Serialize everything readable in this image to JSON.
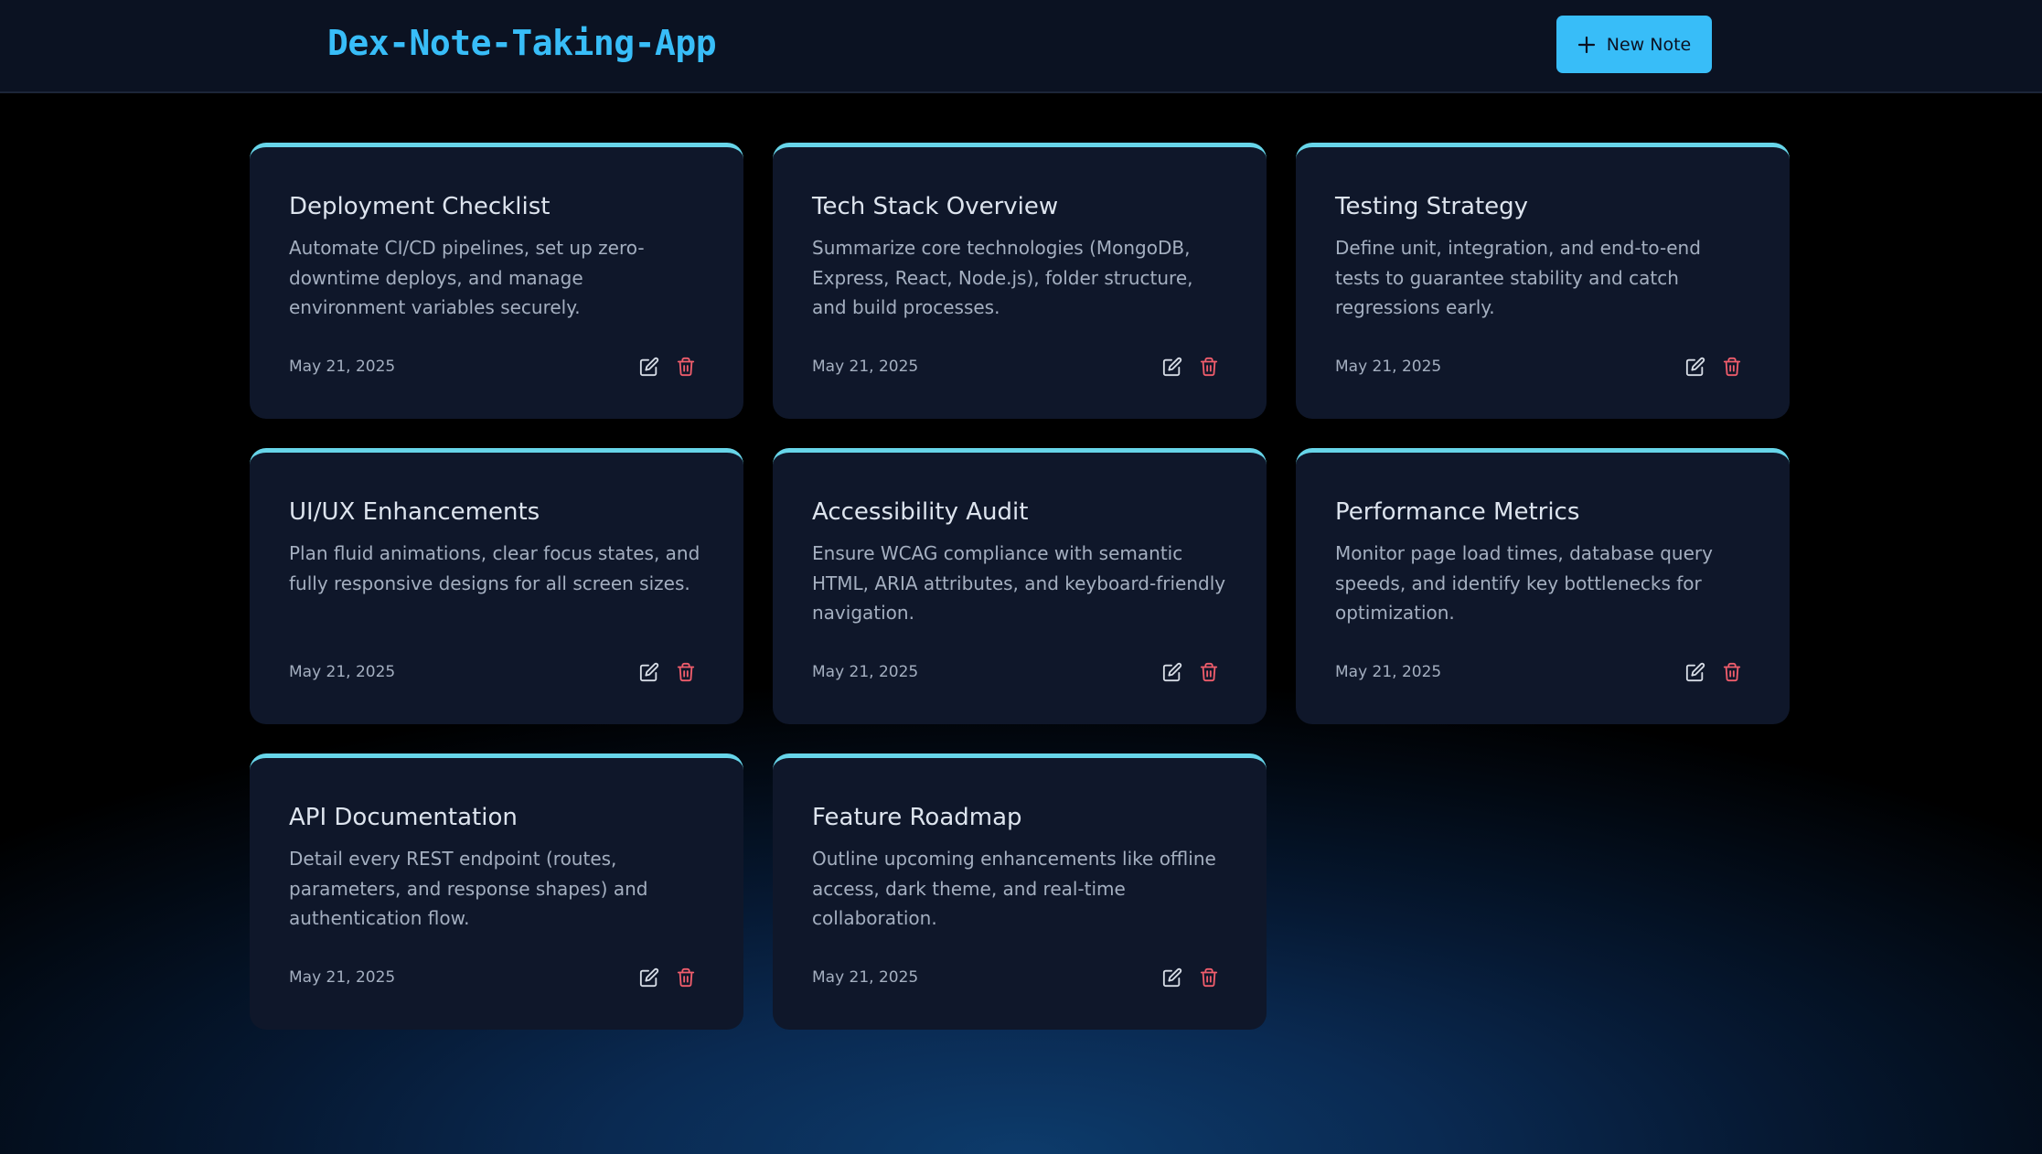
{
  "app": {
    "title": "Dex-Note-Taking-App"
  },
  "header": {
    "new_note_label": "New Note",
    "new_note_icon": "plus-icon"
  },
  "colors": {
    "accent": "#38bdf8",
    "card_top_border": "#67d5e9",
    "card_background": "#0f172a",
    "delete": "#f05d6c",
    "edit": "#d7dde6"
  },
  "notes": [
    {
      "title": "Deployment Checklist",
      "body": "Automate CI/CD pipelines, set up zero-downtime deploys, and manage environment variables securely.",
      "date": "May 21, 2025"
    },
    {
      "title": "Tech Stack Overview",
      "body": "Summarize core technologies (MongoDB, Express, React, Node.js), folder structure, and build processes.",
      "date": "May 21, 2025"
    },
    {
      "title": "Testing Strategy",
      "body": "Define unit, integration, and end-to-end tests to guarantee stability and catch regressions early.",
      "date": "May 21, 2025"
    },
    {
      "title": "UI/UX Enhancements",
      "body": "Plan fluid animations, clear focus states, and fully responsive designs for all screen sizes.",
      "date": "May 21, 2025"
    },
    {
      "title": "Accessibility Audit",
      "body": "Ensure WCAG compliance with semantic HTML, ARIA attributes, and keyboard-friendly navigation.",
      "date": "May 21, 2025"
    },
    {
      "title": "Performance Metrics",
      "body": "Monitor page load times, database query speeds, and identify key bottlenecks for optimization.",
      "date": "May 21, 2025"
    },
    {
      "title": "API Documentation",
      "body": "Detail every REST endpoint (routes, parameters, and response shapes) and authentication flow.",
      "date": "May 21, 2025"
    },
    {
      "title": "Feature Roadmap",
      "body": "Outline upcoming enhancements like offline access, dark theme, and real-time collaboration.",
      "date": "May 21, 2025"
    }
  ]
}
